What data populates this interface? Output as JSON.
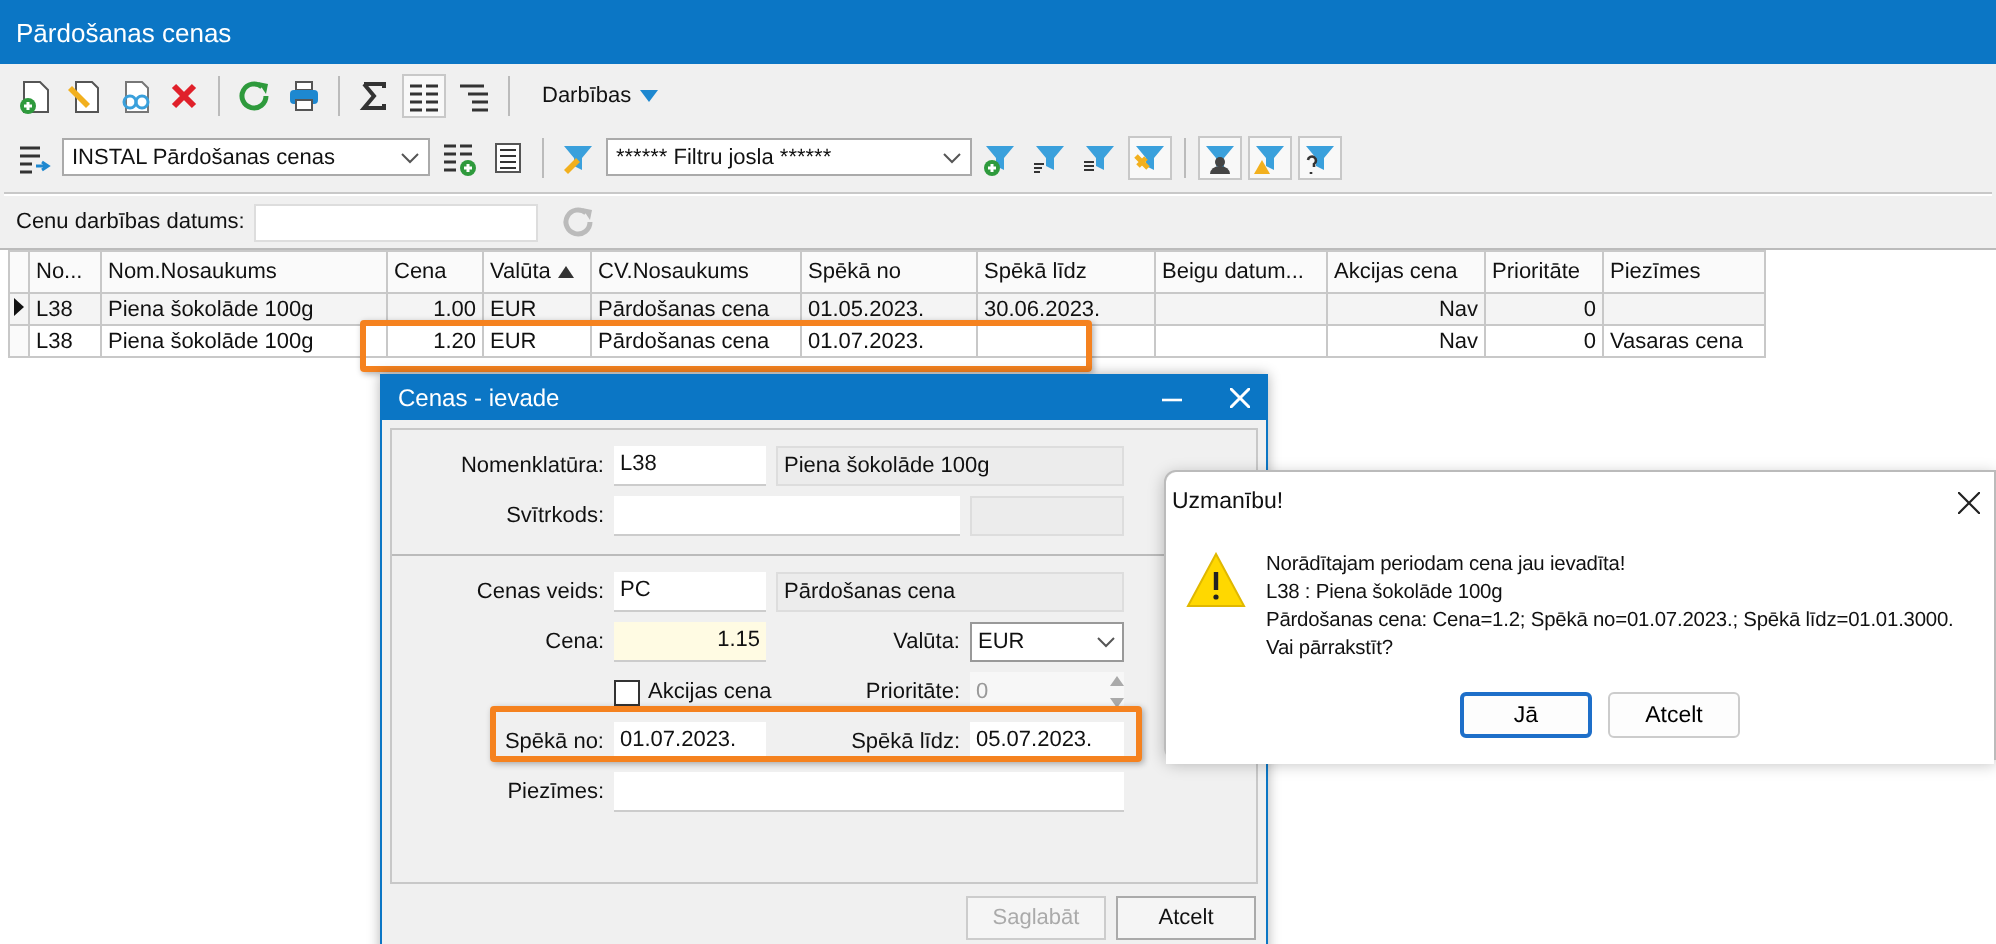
{
  "window": {
    "title": "Pārdošanas cenas"
  },
  "toolbar": {
    "actions_menu": "Darbības"
  },
  "view_combo": {
    "value": "INSTAL Pārdošanas cenas"
  },
  "filter_combo": {
    "value": "****** Filtru josla ******"
  },
  "date_filter": {
    "label": "Cenu darbības datums:"
  },
  "table": {
    "columns": [
      {
        "label": "No...",
        "kind": "text",
        "sorted": false
      },
      {
        "label": "Nom.Nosaukums",
        "kind": "text",
        "sorted": false
      },
      {
        "label": "Cena",
        "kind": "number",
        "sorted": false
      },
      {
        "label": "Valūta",
        "kind": "text",
        "sorted": true
      },
      {
        "label": "CV.Nosaukums",
        "kind": "text",
        "sorted": false
      },
      {
        "label": "Spēkā no",
        "kind": "text",
        "sorted": false
      },
      {
        "label": "Spēkā līdz",
        "kind": "text",
        "sorted": false
      },
      {
        "label": "Beigu datum...",
        "kind": "text",
        "sorted": false
      },
      {
        "label": "Akcijas cena",
        "kind": "number",
        "sorted": false
      },
      {
        "label": "Prioritāte",
        "kind": "number",
        "sorted": false
      },
      {
        "label": "Piezīmes",
        "kind": "text",
        "sorted": false
      }
    ],
    "rows": [
      {
        "current": true,
        "cells": [
          "L38",
          "Piena šokolāde 100g",
          "1.00",
          "EUR",
          "Pārdošanas cena",
          "01.05.2023.",
          "30.06.2023.",
          null,
          "Nav",
          "0",
          null
        ]
      },
      {
        "current": false,
        "cells": [
          "L38",
          "Piena šokolāde 100g",
          "1.20",
          "EUR",
          "Pārdošanas cena",
          "01.07.2023.",
          null,
          null,
          "Nav",
          "0",
          "Vasaras cena"
        ]
      }
    ]
  },
  "entry_dialog": {
    "title": "Cenas - ievade",
    "nomenclature": {
      "label": "Nomenklatūra:",
      "code": "L38",
      "name": "Piena šokolāde 100g"
    },
    "barcode": {
      "label": "Svītrkods:"
    },
    "price_type": {
      "label": "Cenas veids:",
      "code": "PC",
      "name": "Pārdošanas cena"
    },
    "price": {
      "label": "Cena:",
      "value": "1.15"
    },
    "currency": {
      "label": "Valūta:",
      "value": "EUR"
    },
    "promo": {
      "label": "Akcijas cena",
      "checked": false
    },
    "priority": {
      "label": "Prioritāte:",
      "value": "0",
      "disabled": true
    },
    "valid_from": {
      "label": "Spēkā no:",
      "value": "01.07.2023."
    },
    "valid_to": {
      "label": "Spēkā līdz:",
      "value": "05.07.2023."
    },
    "notes": {
      "label": "Piezīmes:"
    },
    "buttons": [
      {
        "label": "Saglabāt",
        "disabled": true
      },
      {
        "label": "Atcelt",
        "disabled": false
      }
    ]
  },
  "message_box": {
    "title": "Uzmanību!",
    "lines": [
      "Norādītajam periodam cena jau ievadīta!",
      "L38 : Piena šokolāde 100g",
      "Pārdošanas cena: Cena=1.2; Spēkā no=01.07.2023.; Spēkā līdz=01.01.3000.",
      "Vai pārrakstīt?"
    ],
    "buttons": [
      {
        "label": "Jā",
        "default": true
      },
      {
        "label": "Atcelt",
        "default": false
      }
    ]
  }
}
